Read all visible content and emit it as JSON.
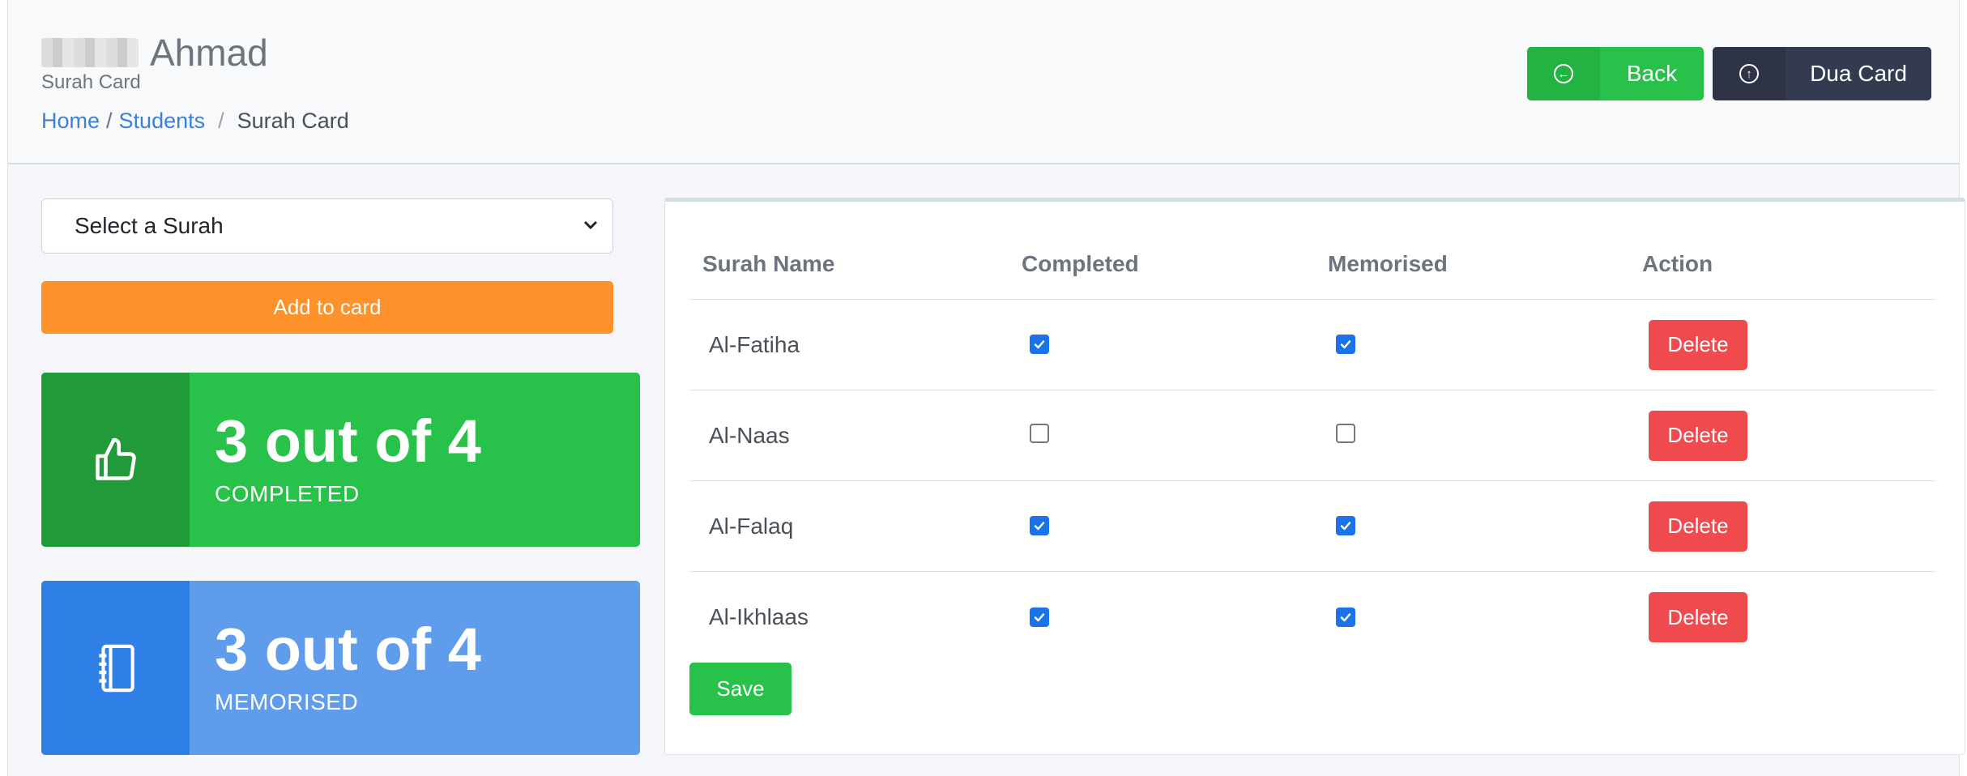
{
  "header": {
    "title": "Ahmad",
    "subtitle": "Surah Card",
    "breadcrumb": {
      "home": "Home",
      "students": "Students",
      "current": "Surah Card"
    },
    "back_label": "Back",
    "dua_label": "Dua Card"
  },
  "form": {
    "select_value": "Select a Surah",
    "add_label": "Add to card"
  },
  "stats": {
    "completed": {
      "value": "3 out of 4",
      "label": "COMPLETED"
    },
    "memorised": {
      "value": "3 out of 4",
      "label": "MEMORISED"
    }
  },
  "table": {
    "headers": [
      "Surah Name",
      "Completed",
      "Memorised",
      "Action"
    ],
    "rows": [
      {
        "name": "Al-Fatiha",
        "completed": true,
        "memorised": true,
        "action": "Delete"
      },
      {
        "name": "Al-Naas",
        "completed": false,
        "memorised": false,
        "action": "Delete"
      },
      {
        "name": "Al-Falaq",
        "completed": true,
        "memorised": true,
        "action": "Delete"
      },
      {
        "name": "Al-Ikhlaas",
        "completed": true,
        "memorised": true,
        "action": "Delete"
      }
    ],
    "save_label": "Save"
  },
  "colors": {
    "green": "#28c24a",
    "dark": "#343a4f",
    "orange": "#fd912b",
    "blue": "#5f9cec",
    "red": "#ef4a4e",
    "link": "#3b82d6"
  }
}
